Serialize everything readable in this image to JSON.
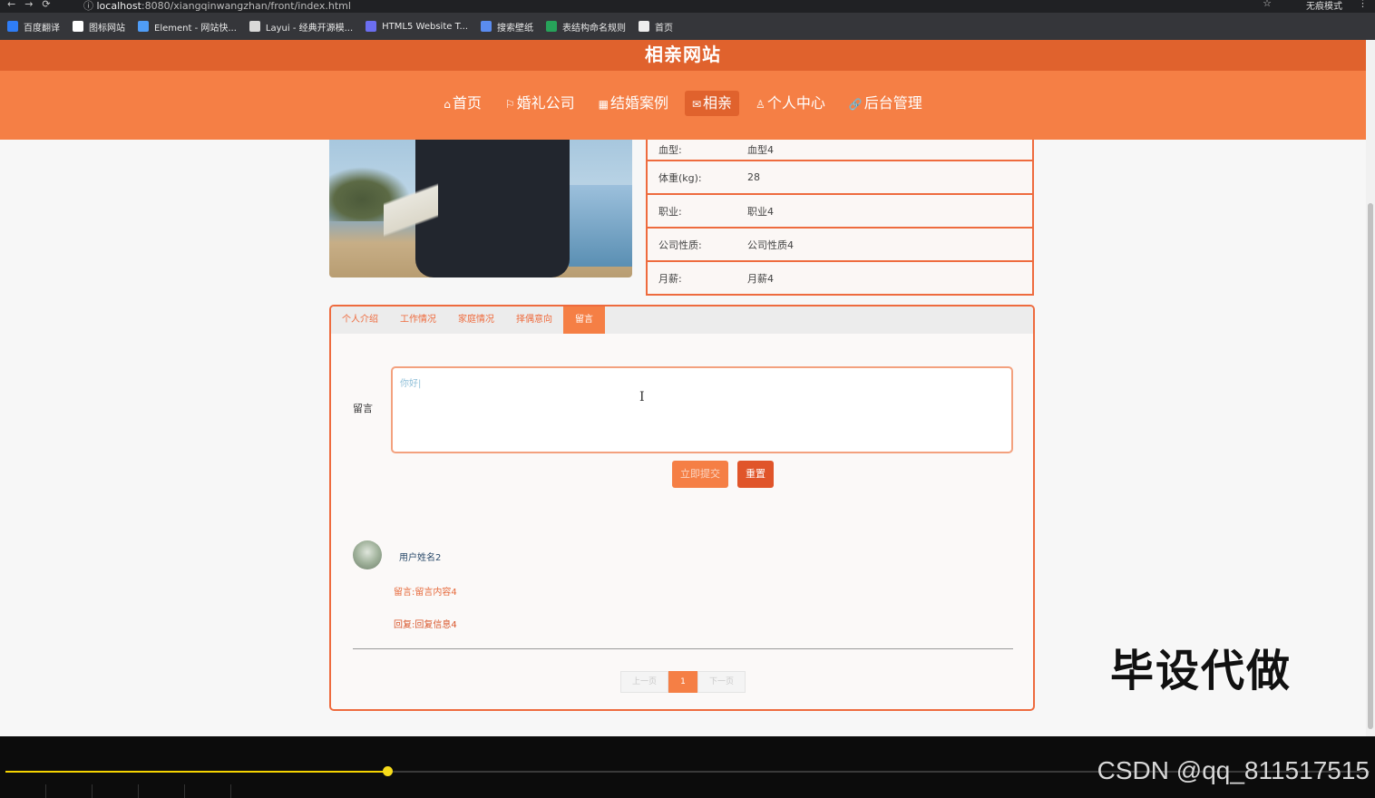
{
  "browser": {
    "url_host": "localhost",
    "url_rest": ":8080/xiangqinwangzhan/front/index.html",
    "incognito_label": "无痕模式",
    "bookmarks": [
      {
        "label": "百度翻译",
        "icon_color": "#2f7df6"
      },
      {
        "label": "图标网站",
        "icon_color": "#ffffff"
      },
      {
        "label": "Element - 网站快...",
        "icon_color": "#4f9df7"
      },
      {
        "label": "Layui - 经典开源模...",
        "icon_color": "#d9d9d9"
      },
      {
        "label": "HTML5 Website T...",
        "icon_color": "#6b6ef0"
      },
      {
        "label": "搜索壁纸",
        "icon_color": "#5a8cf0"
      },
      {
        "label": "表结构命名规则",
        "icon_color": "#27a35a"
      },
      {
        "label": "首页",
        "icon_color": "#eeeeee"
      }
    ]
  },
  "site": {
    "title": "相亲网站",
    "nav": [
      {
        "icon": "⌂",
        "label": "首页"
      },
      {
        "icon": "⚐",
        "label": "婚礼公司"
      },
      {
        "icon": "▦",
        "label": "结婚案例"
      },
      {
        "icon": "✉",
        "label": "相亲"
      },
      {
        "icon": "♙",
        "label": "个人中心"
      },
      {
        "icon": "🔗",
        "label": "后台管理"
      }
    ],
    "active_nav": "相亲"
  },
  "profile": {
    "rows": [
      {
        "label": "血型:",
        "value": "血型4"
      },
      {
        "label": "体重(kg):",
        "value": "28"
      },
      {
        "label": "职业:",
        "value": "职业4"
      },
      {
        "label": "公司性质:",
        "value": "公司性质4"
      },
      {
        "label": "月薪:",
        "value": "月薪4"
      }
    ]
  },
  "tabs": [
    "个人介绍",
    "工作情况",
    "家庭情况",
    "择偶意向",
    "留言"
  ],
  "active_tab": "留言",
  "message_form": {
    "label": "留言",
    "value": "你好|",
    "submit_label": "立即提交",
    "reset_label": "重置"
  },
  "comment": {
    "user": "用户姓名2",
    "message": "留言:留言内容4",
    "reply": "回复:回复信息4"
  },
  "pagination": {
    "prev": "上一页",
    "current": "1",
    "next": "下一页"
  },
  "overlay": {
    "watermark": "毕设代做",
    "csdn": "CSDN @qq_811517515"
  },
  "player": {
    "progress": 0.28
  }
}
